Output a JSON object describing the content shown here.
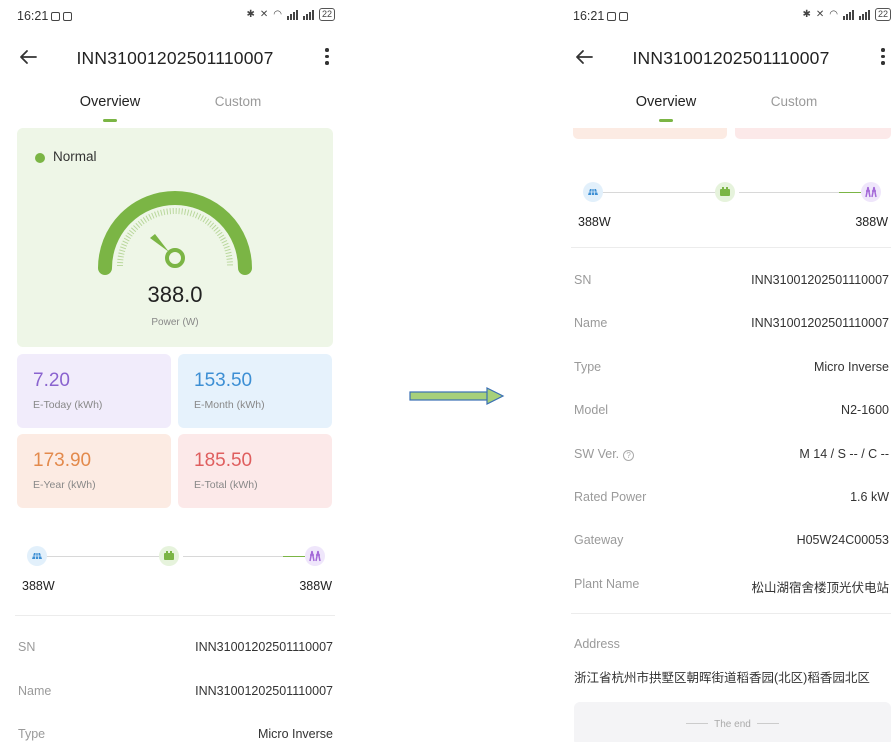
{
  "status_bar": {
    "time": "16:21",
    "battery": "22"
  },
  "header": {
    "title": "INN31001202501110007"
  },
  "tabs": [
    {
      "label": "Overview",
      "active": true
    },
    {
      "label": "Custom",
      "active": false
    }
  ],
  "gauge": {
    "status": "Normal",
    "power_value": "388.0",
    "power_label": "Power (W)"
  },
  "stats": {
    "today": {
      "value": "7.20",
      "label": "E-Today (kWh)"
    },
    "month": {
      "value": "153.50",
      "label": "E-Month (kWh)"
    },
    "year": {
      "value": "173.90",
      "label": "E-Year (kWh)"
    },
    "total": {
      "value": "185.50",
      "label": "E-Total (kWh)"
    }
  },
  "flow": {
    "solar_power": "388W",
    "grid_power": "388W"
  },
  "info": [
    {
      "key": "SN",
      "value": "INN31001202501110007"
    },
    {
      "key": "Name",
      "value": "INN31001202501110007"
    },
    {
      "key": "Type",
      "value": "Micro Inverse"
    },
    {
      "key": "Model",
      "value": "N2-1600"
    },
    {
      "key": "SW Ver.",
      "value": "M 14 / S -- / C --"
    },
    {
      "key": "Rated Power",
      "value": "1.6 kW"
    },
    {
      "key": "Gateway",
      "value": "H05W24C00053"
    },
    {
      "key": "Plant Name",
      "value": "松山湖宿舍楼顶光伏电站"
    }
  ],
  "address": {
    "label": "Address",
    "value": "浙江省杭州市拱墅区朝晖街道稻香园(北区)稻香园北区"
  },
  "footer": {
    "end_text": "The end"
  },
  "colors": {
    "accent_green": "#7bb545",
    "today": "#8a63cf",
    "month": "#3d8fd4",
    "year": "#e38a4c",
    "total": "#df5e5e"
  }
}
